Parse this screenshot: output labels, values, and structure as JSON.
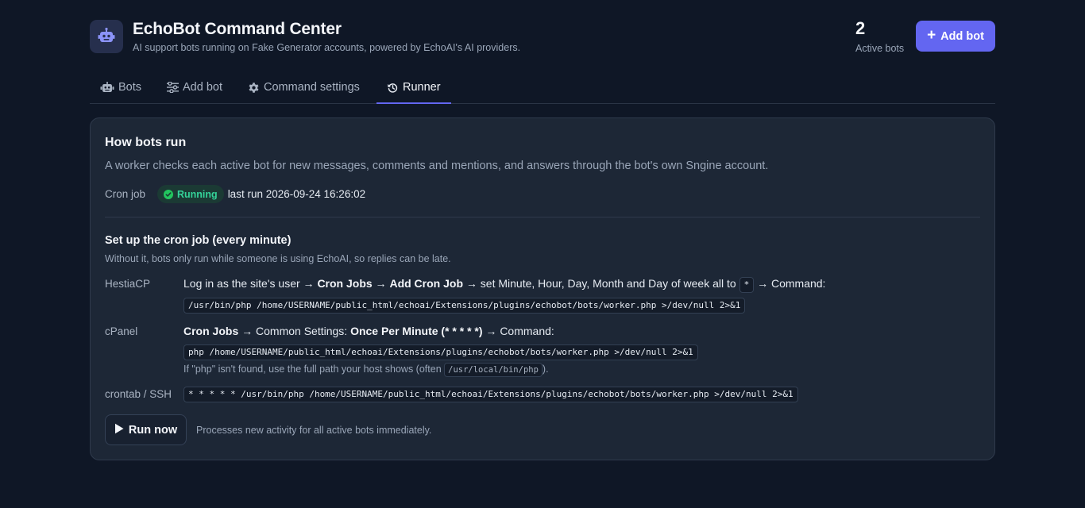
{
  "header": {
    "title": "EchoBot Command Center",
    "subtitle": "AI support bots running on Fake Generator accounts, powered by EchoAI's AI providers.",
    "stat_value": "2",
    "stat_label": "Active bots",
    "add_button_label": "Add bot"
  },
  "tabs": [
    {
      "label": "Bots",
      "icon": "robot-icon",
      "active": false
    },
    {
      "label": "Add bot",
      "icon": "sliders-icon",
      "active": false
    },
    {
      "label": "Command settings",
      "icon": "gear-icon",
      "active": false
    },
    {
      "label": "Runner",
      "icon": "history-icon",
      "active": true
    }
  ],
  "runner": {
    "title": "How bots run",
    "description": "A worker checks each active bot for new messages, comments and mentions, and answers through the bot's own Sngine account.",
    "cron_label": "Cron job",
    "status_badge": "Running",
    "last_run_label": "last run",
    "last_run": "2026-09-24 16:26:02",
    "setup_title": "Set up the cron job (every minute)",
    "setup_note": "Without it, bots only run while someone is using EchoAI, so replies can be late.",
    "hestia": {
      "label": "HestiaCP",
      "t1": "Log in as the site's user → ",
      "b1": "Cron Jobs",
      "t2": " → ",
      "b2": "Add Cron Job",
      "t3": " → set Minute, Hour, Day, Month and Day of week all to ",
      "star": "*",
      "t4": " → Command:",
      "command": "/usr/bin/php /home/USERNAME/public_html/echoai/Extensions/plugins/echobot/bots/worker.php >/dev/null 2>&1"
    },
    "cpanel": {
      "label": "cPanel",
      "b1": "Cron Jobs",
      "t1": " → Common Settings: ",
      "b2": "Once Per Minute (* * * * *)",
      "t2": " → Command:",
      "command": "php /home/USERNAME/public_html/echoai/Extensions/plugins/echobot/bots/worker.php >/dev/null 2>&1",
      "hint_pre": "If \"php\" isn't found, use the full path your host shows (often ",
      "hint_code": "/usr/local/bin/php",
      "hint_post": ")."
    },
    "crontab": {
      "label": "crontab / SSH",
      "command": "* * * * * /usr/bin/php /home/USERNAME/public_html/echoai/Extensions/plugins/echobot/bots/worker.php >/dev/null 2>&1"
    },
    "run_button_label": "Run now",
    "run_hint": "Processes new activity for all active bots immediately."
  },
  "colors": {
    "background": "#0f1726",
    "card": "#1d2736",
    "accent": "#6366f1",
    "success": "#34d399"
  }
}
